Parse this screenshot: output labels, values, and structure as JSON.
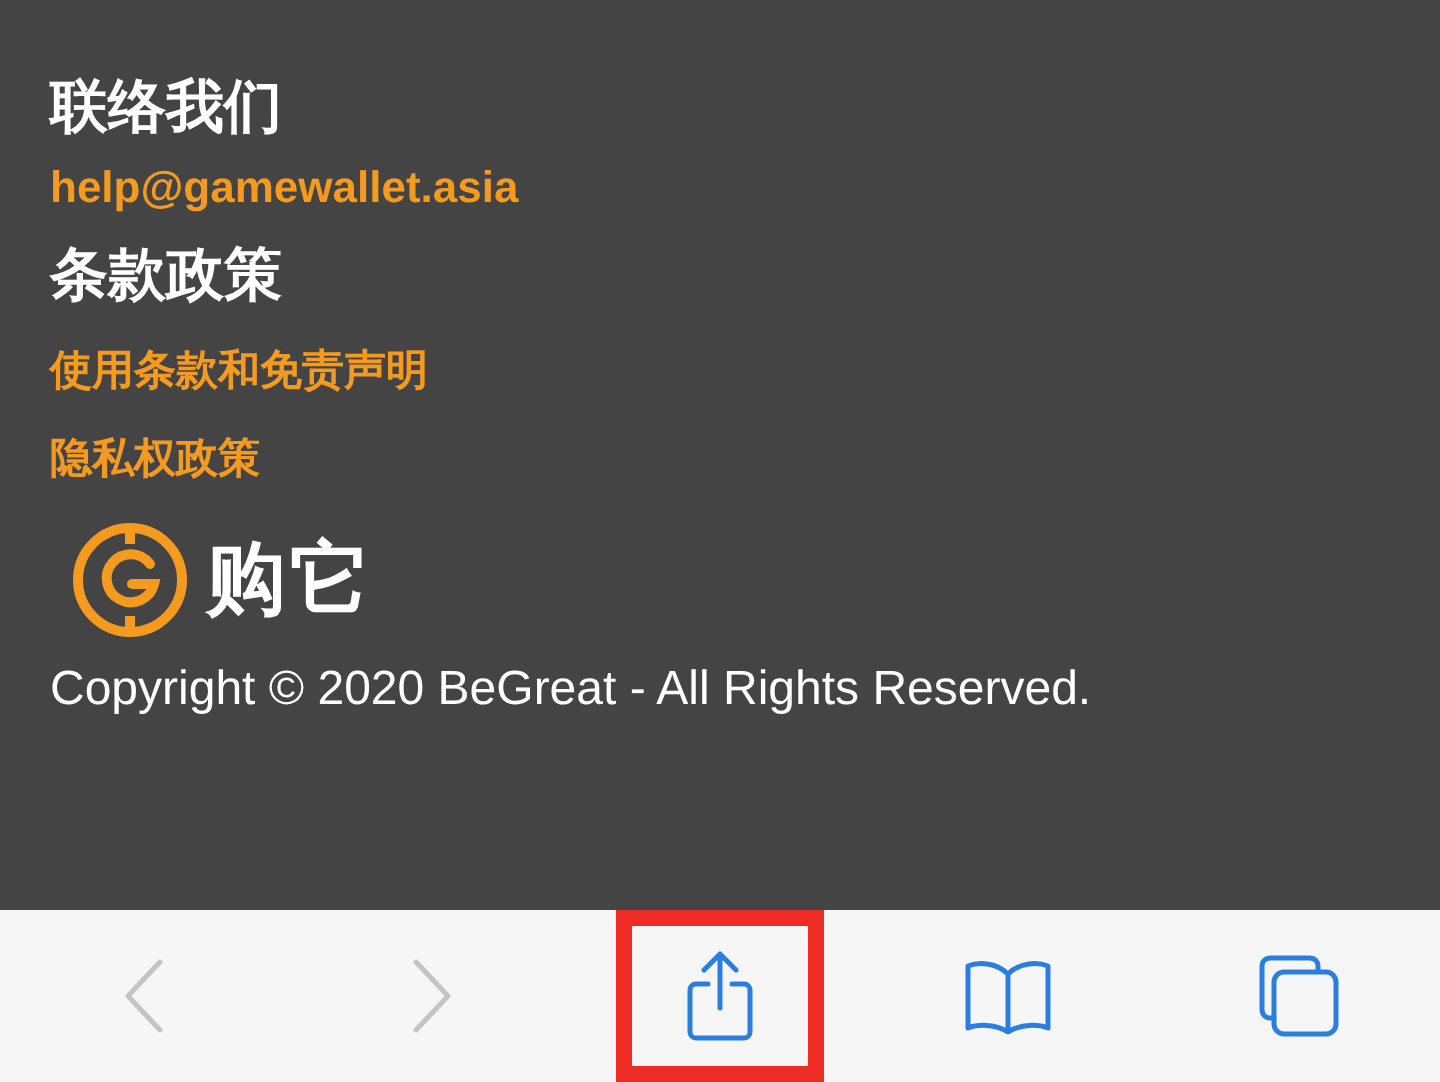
{
  "footer": {
    "contact_heading": "联络我们",
    "email": "help@gamewallet.asia",
    "policy_heading": "条款政策",
    "links": [
      "使用条款和免责声明",
      "隐私权政策"
    ],
    "logo_text": "购它",
    "copyright": "Copyright © 2020 BeGreat - All Rights Reserved."
  },
  "toolbar": {
    "buttons": [
      {
        "kind": "back",
        "disabled": true,
        "highlighted": false
      },
      {
        "kind": "forward",
        "disabled": true,
        "highlighted": false
      },
      {
        "kind": "share",
        "disabled": false,
        "highlighted": true
      },
      {
        "kind": "bookmarks",
        "disabled": false,
        "highlighted": false
      },
      {
        "kind": "tabs",
        "disabled": false,
        "highlighted": false
      }
    ]
  }
}
